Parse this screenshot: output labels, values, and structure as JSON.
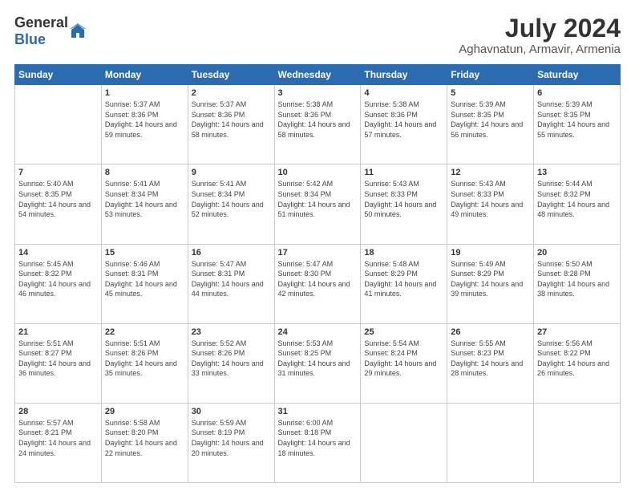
{
  "logo": {
    "general": "General",
    "blue": "Blue"
  },
  "title": "July 2024",
  "subtitle": "Aghavnatun, Armavir, Armenia",
  "headers": [
    "Sunday",
    "Monday",
    "Tuesday",
    "Wednesday",
    "Thursday",
    "Friday",
    "Saturday"
  ],
  "weeks": [
    [
      {
        "day": "",
        "sunrise": "",
        "sunset": "",
        "daylight": ""
      },
      {
        "day": "1",
        "sunrise": "Sunrise: 5:37 AM",
        "sunset": "Sunset: 8:36 PM",
        "daylight": "Daylight: 14 hours and 59 minutes."
      },
      {
        "day": "2",
        "sunrise": "Sunrise: 5:37 AM",
        "sunset": "Sunset: 8:36 PM",
        "daylight": "Daylight: 14 hours and 58 minutes."
      },
      {
        "day": "3",
        "sunrise": "Sunrise: 5:38 AM",
        "sunset": "Sunset: 8:36 PM",
        "daylight": "Daylight: 14 hours and 58 minutes."
      },
      {
        "day": "4",
        "sunrise": "Sunrise: 5:38 AM",
        "sunset": "Sunset: 8:36 PM",
        "daylight": "Daylight: 14 hours and 57 minutes."
      },
      {
        "day": "5",
        "sunrise": "Sunrise: 5:39 AM",
        "sunset": "Sunset: 8:35 PM",
        "daylight": "Daylight: 14 hours and 56 minutes."
      },
      {
        "day": "6",
        "sunrise": "Sunrise: 5:39 AM",
        "sunset": "Sunset: 8:35 PM",
        "daylight": "Daylight: 14 hours and 55 minutes."
      }
    ],
    [
      {
        "day": "7",
        "sunrise": "Sunrise: 5:40 AM",
        "sunset": "Sunset: 8:35 PM",
        "daylight": "Daylight: 14 hours and 54 minutes."
      },
      {
        "day": "8",
        "sunrise": "Sunrise: 5:41 AM",
        "sunset": "Sunset: 8:34 PM",
        "daylight": "Daylight: 14 hours and 53 minutes."
      },
      {
        "day": "9",
        "sunrise": "Sunrise: 5:41 AM",
        "sunset": "Sunset: 8:34 PM",
        "daylight": "Daylight: 14 hours and 52 minutes."
      },
      {
        "day": "10",
        "sunrise": "Sunrise: 5:42 AM",
        "sunset": "Sunset: 8:34 PM",
        "daylight": "Daylight: 14 hours and 51 minutes."
      },
      {
        "day": "11",
        "sunrise": "Sunrise: 5:43 AM",
        "sunset": "Sunset: 8:33 PM",
        "daylight": "Daylight: 14 hours and 50 minutes."
      },
      {
        "day": "12",
        "sunrise": "Sunrise: 5:43 AM",
        "sunset": "Sunset: 8:33 PM",
        "daylight": "Daylight: 14 hours and 49 minutes."
      },
      {
        "day": "13",
        "sunrise": "Sunrise: 5:44 AM",
        "sunset": "Sunset: 8:32 PM",
        "daylight": "Daylight: 14 hours and 48 minutes."
      }
    ],
    [
      {
        "day": "14",
        "sunrise": "Sunrise: 5:45 AM",
        "sunset": "Sunset: 8:32 PM",
        "daylight": "Daylight: 14 hours and 46 minutes."
      },
      {
        "day": "15",
        "sunrise": "Sunrise: 5:46 AM",
        "sunset": "Sunset: 8:31 PM",
        "daylight": "Daylight: 14 hours and 45 minutes."
      },
      {
        "day": "16",
        "sunrise": "Sunrise: 5:47 AM",
        "sunset": "Sunset: 8:31 PM",
        "daylight": "Daylight: 14 hours and 44 minutes."
      },
      {
        "day": "17",
        "sunrise": "Sunrise: 5:47 AM",
        "sunset": "Sunset: 8:30 PM",
        "daylight": "Daylight: 14 hours and 42 minutes."
      },
      {
        "day": "18",
        "sunrise": "Sunrise: 5:48 AM",
        "sunset": "Sunset: 8:29 PM",
        "daylight": "Daylight: 14 hours and 41 minutes."
      },
      {
        "day": "19",
        "sunrise": "Sunrise: 5:49 AM",
        "sunset": "Sunset: 8:29 PM",
        "daylight": "Daylight: 14 hours and 39 minutes."
      },
      {
        "day": "20",
        "sunrise": "Sunrise: 5:50 AM",
        "sunset": "Sunset: 8:28 PM",
        "daylight": "Daylight: 14 hours and 38 minutes."
      }
    ],
    [
      {
        "day": "21",
        "sunrise": "Sunrise: 5:51 AM",
        "sunset": "Sunset: 8:27 PM",
        "daylight": "Daylight: 14 hours and 36 minutes."
      },
      {
        "day": "22",
        "sunrise": "Sunrise: 5:51 AM",
        "sunset": "Sunset: 8:26 PM",
        "daylight": "Daylight: 14 hours and 35 minutes."
      },
      {
        "day": "23",
        "sunrise": "Sunrise: 5:52 AM",
        "sunset": "Sunset: 8:26 PM",
        "daylight": "Daylight: 14 hours and 33 minutes."
      },
      {
        "day": "24",
        "sunrise": "Sunrise: 5:53 AM",
        "sunset": "Sunset: 8:25 PM",
        "daylight": "Daylight: 14 hours and 31 minutes."
      },
      {
        "day": "25",
        "sunrise": "Sunrise: 5:54 AM",
        "sunset": "Sunset: 8:24 PM",
        "daylight": "Daylight: 14 hours and 29 minutes."
      },
      {
        "day": "26",
        "sunrise": "Sunrise: 5:55 AM",
        "sunset": "Sunset: 8:23 PM",
        "daylight": "Daylight: 14 hours and 28 minutes."
      },
      {
        "day": "27",
        "sunrise": "Sunrise: 5:56 AM",
        "sunset": "Sunset: 8:22 PM",
        "daylight": "Daylight: 14 hours and 26 minutes."
      }
    ],
    [
      {
        "day": "28",
        "sunrise": "Sunrise: 5:57 AM",
        "sunset": "Sunset: 8:21 PM",
        "daylight": "Daylight: 14 hours and 24 minutes."
      },
      {
        "day": "29",
        "sunrise": "Sunrise: 5:58 AM",
        "sunset": "Sunset: 8:20 PM",
        "daylight": "Daylight: 14 hours and 22 minutes."
      },
      {
        "day": "30",
        "sunrise": "Sunrise: 5:59 AM",
        "sunset": "Sunset: 8:19 PM",
        "daylight": "Daylight: 14 hours and 20 minutes."
      },
      {
        "day": "31",
        "sunrise": "Sunrise: 6:00 AM",
        "sunset": "Sunset: 8:18 PM",
        "daylight": "Daylight: 14 hours and 18 minutes."
      },
      {
        "day": "",
        "sunrise": "",
        "sunset": "",
        "daylight": ""
      },
      {
        "day": "",
        "sunrise": "",
        "sunset": "",
        "daylight": ""
      },
      {
        "day": "",
        "sunrise": "",
        "sunset": "",
        "daylight": ""
      }
    ]
  ]
}
